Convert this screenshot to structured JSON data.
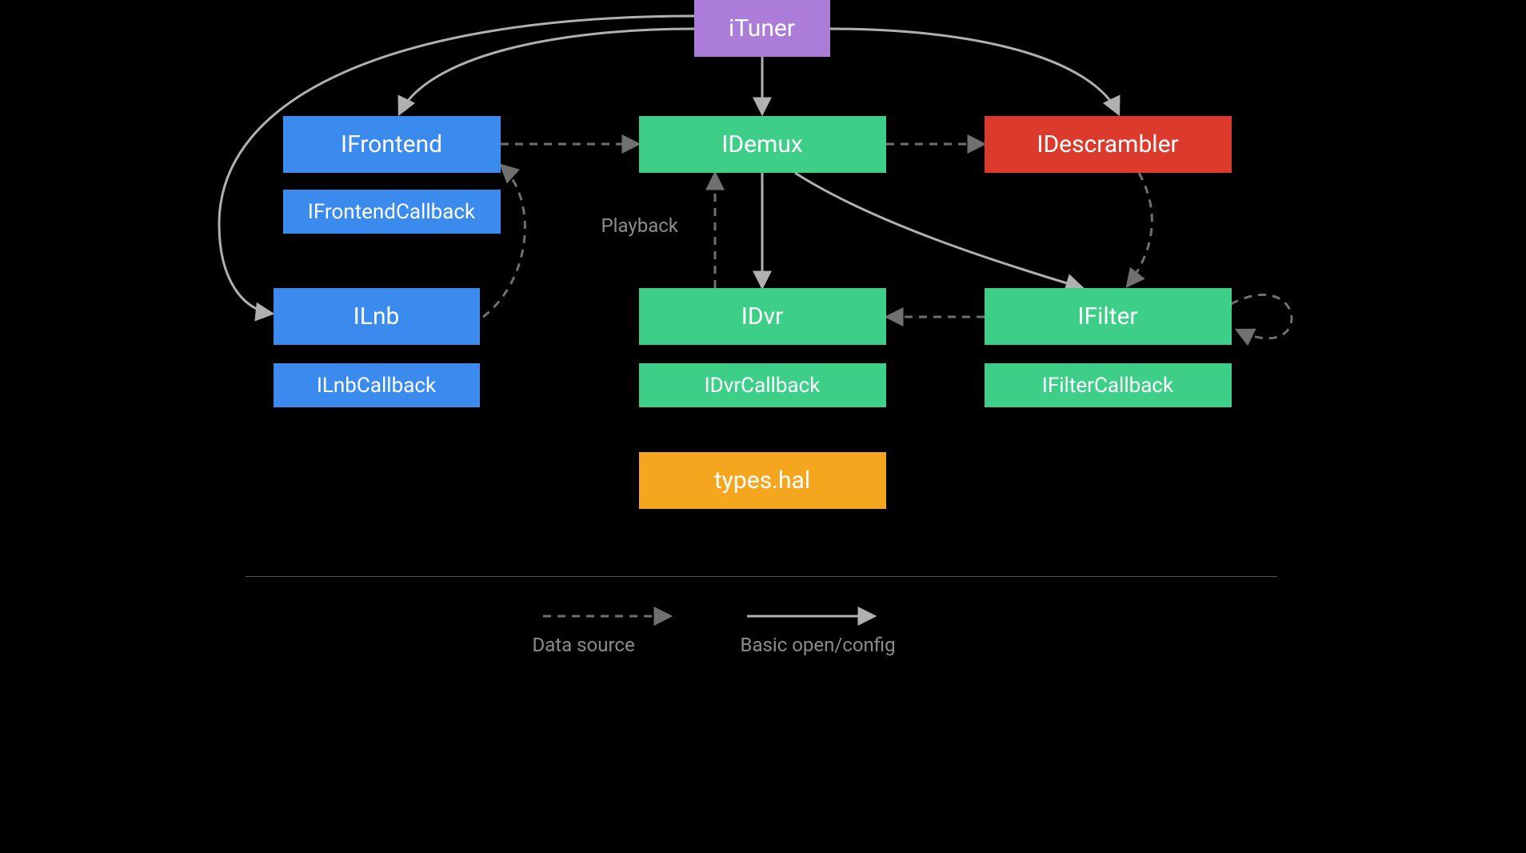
{
  "diagram": {
    "nodes": {
      "ituner": "iTuner",
      "ifrontend": "IFrontend",
      "ifrontend_cb": "IFrontendCallback",
      "ilnb": "ILnb",
      "ilnb_cb": "ILnbCallback",
      "idemux": "IDemux",
      "idvr": "IDvr",
      "idvr_cb": "IDvrCallback",
      "types_hal": "types.hal",
      "idescrambler": "IDescrambler",
      "ifilter": "IFilter",
      "ifilter_cb": "IFilterCallback"
    },
    "labels": {
      "playback": "Playback"
    },
    "legend": {
      "dashed": "Data source",
      "solid": "Basic open/config"
    },
    "edges": {
      "solid": [
        {
          "from": "iTuner",
          "to": "IFrontend"
        },
        {
          "from": "iTuner",
          "to": "IDemux"
        },
        {
          "from": "iTuner",
          "to": "IDescrambler"
        },
        {
          "from": "iTuner",
          "to": "ILnb"
        },
        {
          "from": "IDemux",
          "to": "IDvr"
        },
        {
          "from": "IDemux",
          "to": "IFilter"
        }
      ],
      "dashed": [
        {
          "from": "IFrontend",
          "to": "IDemux"
        },
        {
          "from": "IDemux",
          "to": "IDescrambler"
        },
        {
          "from": "ILnb",
          "to": "IFrontend"
        },
        {
          "from": "IDvr",
          "to": "IDemux",
          "label": "Playback"
        },
        {
          "from": "IFilter",
          "to": "IDvr"
        },
        {
          "from": "IDescrambler",
          "to": "IFilter"
        },
        {
          "from": "IFilter",
          "to": "IFilter",
          "note": "self-loop"
        }
      ]
    },
    "colors": {
      "purple": "#AB7DD8",
      "blue": "#3B8BEF",
      "green": "#3DCE87",
      "red": "#DB3A2C",
      "orange": "#F4A61E",
      "arrow_solid": "#b0b0b0",
      "arrow_dashed": "#707070"
    }
  }
}
